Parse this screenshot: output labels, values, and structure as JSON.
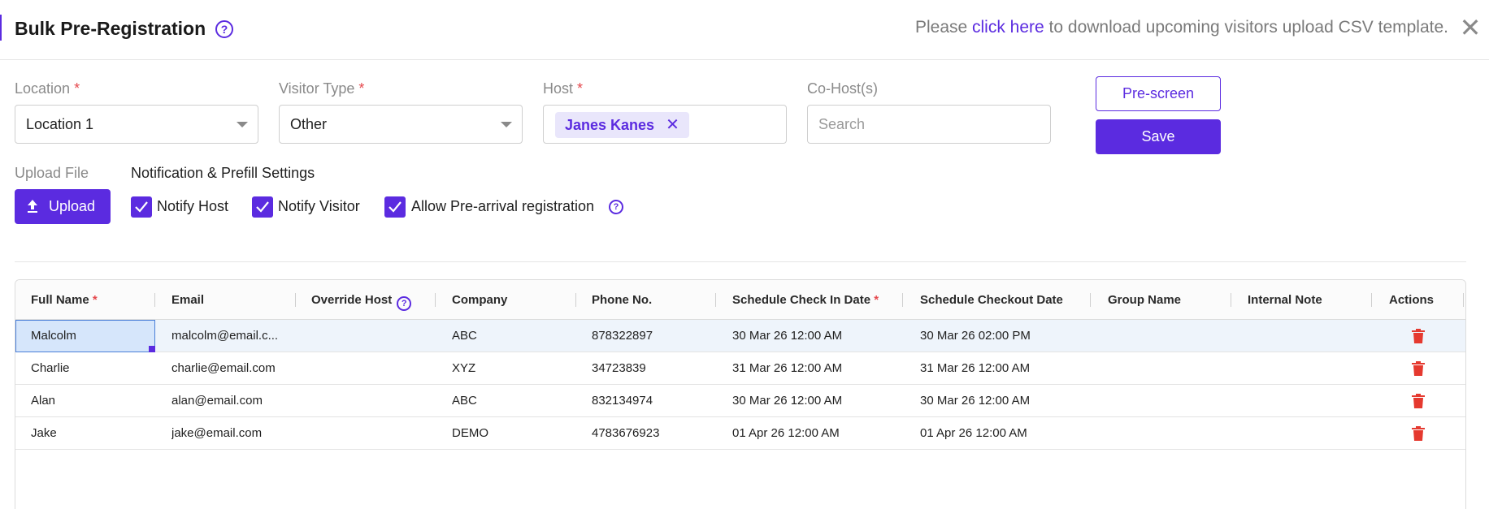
{
  "header": {
    "title": "Bulk Pre-Registration",
    "help_glyph": "?",
    "notice_prefix": "Please ",
    "notice_link": "click here",
    "notice_suffix": " to download upcoming visitors upload CSV template.",
    "close_glyph": "✕"
  },
  "form": {
    "location": {
      "label": "Location",
      "required": "*",
      "value": "Location 1"
    },
    "visitor_type": {
      "label": "Visitor Type",
      "required": "*",
      "value": "Other"
    },
    "host": {
      "label": "Host",
      "required": "*",
      "chip": "Janes Kanes",
      "chip_remove": "✕"
    },
    "cohost": {
      "label": "Co-Host(s)",
      "placeholder": "Search"
    },
    "prescreen_label": "Pre-screen",
    "save_label": "Save",
    "upload": {
      "label": "Upload File",
      "button": "Upload"
    },
    "notification": {
      "label": "Notification & Prefill Settings",
      "options": [
        {
          "label": "Notify Host",
          "checked": true
        },
        {
          "label": "Notify Visitor",
          "checked": true
        },
        {
          "label": "Allow Pre-arrival registration",
          "checked": true
        }
      ],
      "help_glyph": "?"
    }
  },
  "table": {
    "columns": [
      {
        "label": "Full Name",
        "required": "*"
      },
      {
        "label": "Email"
      },
      {
        "label": "Override Host",
        "help": "?"
      },
      {
        "label": "Company"
      },
      {
        "label": "Phone No."
      },
      {
        "label": "Schedule Check In Date",
        "required": "*"
      },
      {
        "label": "Schedule Checkout Date"
      },
      {
        "label": "Group Name"
      },
      {
        "label": "Internal Note"
      },
      {
        "label": "Actions"
      }
    ],
    "rows": [
      {
        "name": "Malcolm",
        "email": "malcolm@email.c...",
        "override_host": "",
        "company": "ABC",
        "phone": "878322897",
        "checkin": "30 Mar 26 12:00 AM",
        "checkout": "30 Mar 26 02:00 PM",
        "group": "",
        "note": ""
      },
      {
        "name": "Charlie",
        "email": "charlie@email.com",
        "override_host": "",
        "company": "XYZ",
        "phone": "34723839",
        "checkin": "31 Mar 26 12:00 AM",
        "checkout": "31 Mar 26 12:00 AM",
        "group": "",
        "note": ""
      },
      {
        "name": "Alan",
        "email": "alan@email.com",
        "override_host": "",
        "company": "ABC",
        "phone": "832134974",
        "checkin": "30 Mar 26 12:00 AM",
        "checkout": "30 Mar 26 12:00 AM",
        "group": "",
        "note": ""
      },
      {
        "name": "Jake",
        "email": "jake@email.com",
        "override_host": "",
        "company": "DEMO",
        "phone": "4783676923",
        "checkin": "01 Apr 26 12:00 AM",
        "checkout": "01 Apr 26 12:00 AM",
        "group": "",
        "note": ""
      }
    ],
    "selected_row": 0,
    "action_icon": "trash-icon"
  },
  "colors": {
    "accent": "#5b2be0",
    "danger": "#e5392f",
    "required": "#e5484d",
    "muted_text": "#8a8a8a"
  }
}
